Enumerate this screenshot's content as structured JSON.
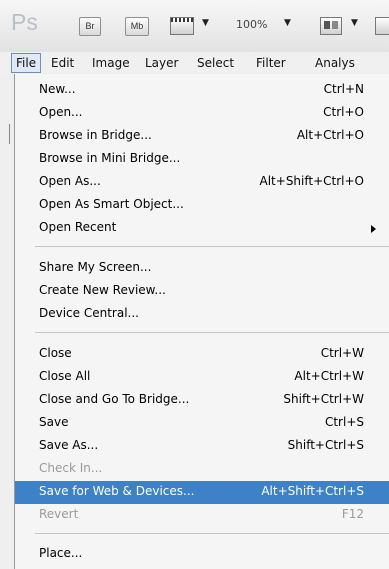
{
  "app": {
    "logo": "Ps",
    "toolbar": {
      "bridge_label": "Br",
      "mini_bridge_label": "Mb",
      "zoom": "100%",
      "dropdown_glyph": "▼"
    }
  },
  "menubar": {
    "items": [
      "File",
      "Edit",
      "Image",
      "Layer",
      "Select",
      "Filter",
      "Analys"
    ]
  },
  "file_menu": {
    "items": [
      {
        "label": "New...",
        "shortcut": "Ctrl+N"
      },
      {
        "label": "Open...",
        "shortcut": "Ctrl+O"
      },
      {
        "label": "Browse in Bridge...",
        "shortcut": "Alt+Ctrl+O"
      },
      {
        "label": "Browse in Mini Bridge...",
        "shortcut": ""
      },
      {
        "label": "Open As...",
        "shortcut": "Alt+Shift+Ctrl+O"
      },
      {
        "label": "Open As Smart Object...",
        "shortcut": ""
      },
      {
        "label": "Open Recent",
        "shortcut": ""
      },
      {
        "label": "Share My Screen...",
        "shortcut": ""
      },
      {
        "label": "Create New Review...",
        "shortcut": ""
      },
      {
        "label": "Device Central...",
        "shortcut": ""
      },
      {
        "label": "Close",
        "shortcut": "Ctrl+W"
      },
      {
        "label": "Close All",
        "shortcut": "Alt+Ctrl+W"
      },
      {
        "label": "Close and Go To Bridge...",
        "shortcut": "Shift+Ctrl+W"
      },
      {
        "label": "Save",
        "shortcut": "Ctrl+S"
      },
      {
        "label": "Save As...",
        "shortcut": "Shift+Ctrl+S"
      },
      {
        "label": "Check In...",
        "shortcut": ""
      },
      {
        "label": "Save for Web & Devices...",
        "shortcut": "Alt+Shift+Ctrl+S"
      },
      {
        "label": "Revert",
        "shortcut": "F12"
      },
      {
        "label": "Place...",
        "shortcut": ""
      }
    ]
  }
}
